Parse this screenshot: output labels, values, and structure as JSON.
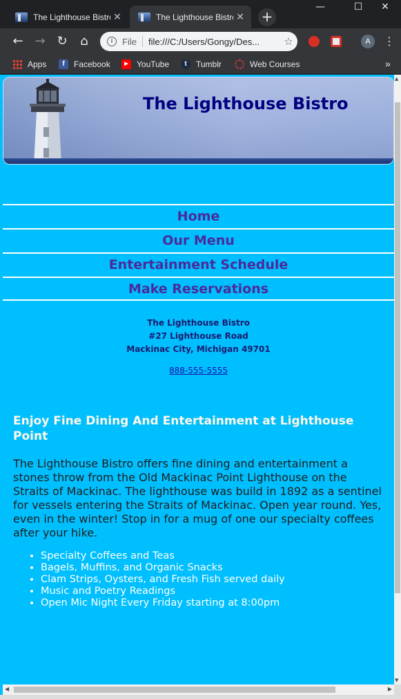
{
  "browser": {
    "tabs": [
      {
        "title": "The Lighthouse Bistro"
      },
      {
        "title": "The Lighthouse Bistro"
      }
    ],
    "new_tab_icon": "plus-icon",
    "window_controls": [
      "minimize-icon",
      "maximize-icon",
      "close-icon"
    ],
    "address": {
      "scheme_label": "File",
      "url": "file:///C:/Users/Gongy/Des..."
    },
    "avatar_letter": "A",
    "bookmarks": [
      {
        "label": "Apps",
        "icon": "apps-grid-icon"
      },
      {
        "label": "Facebook",
        "icon": "facebook-icon"
      },
      {
        "label": "YouTube",
        "icon": "youtube-icon"
      },
      {
        "label": "Tumblr",
        "icon": "tumblr-icon"
      },
      {
        "label": "Web Courses",
        "icon": "web-courses-icon"
      }
    ],
    "bookmarks_more": "»"
  },
  "site": {
    "title": "The Lighthouse Bistro",
    "nav": [
      {
        "label": "Home"
      },
      {
        "label": "Our Menu"
      },
      {
        "label": "Entertainment Schedule"
      },
      {
        "label": "Make Reservations"
      }
    ],
    "address": {
      "name": "The Lighthouse Bistro",
      "street": "#27 Lighthouse Road",
      "city": "Mackinac City, Michigan 49701",
      "phone": "888-555-5555"
    },
    "heading": "Enjoy Fine Dining And Entertainment at Lighthouse Point",
    "paragraph": "The Lighthouse Bistro offers fine dining and entertainment a stones throw from the Old Mackinac Point Lighthouse on the Straits of Mackinac. The lighthouse was build in 1892 as a sentinel for vessels entering the Straits of Mackinac. Open year round. Yes, even in the winter! Stop in for a mug of one our specialty coffees after your hike.",
    "features": [
      "Specialty Coffees and Teas",
      "Bagels, Muffins, and Organic Snacks",
      "Clam Strips, Oysters, and Fresh Fish served daily",
      "Music and Poetry Readings",
      "Open Mic Night Every Friday starting at 8:00pm"
    ]
  },
  "colors": {
    "page_background": "#00bfff",
    "site_title": "#000080",
    "nav_link": "#4b2a9b",
    "heading": "#fff8e8",
    "features": "#ffffff"
  }
}
